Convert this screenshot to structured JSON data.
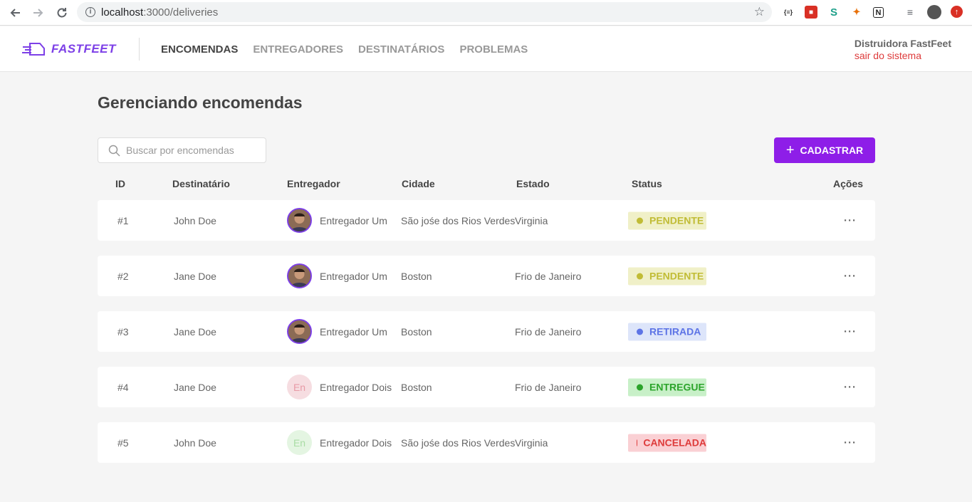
{
  "browser": {
    "url_host": "localhost",
    "url_path": ":3000/deliveries"
  },
  "header": {
    "logo_text": "FASTFEET",
    "nav": [
      {
        "label": "ENCOMENDAS",
        "active": true
      },
      {
        "label": "ENTREGADORES",
        "active": false
      },
      {
        "label": "DESTINATÁRIOS",
        "active": false
      },
      {
        "label": "PROBLEMAS",
        "active": false
      }
    ],
    "user_name": "Distruidora FastFeet",
    "logout_label": "sair do sistema"
  },
  "main": {
    "title": "Gerenciando encomendas",
    "search_placeholder": "Buscar por encomendas",
    "add_button_label": "CADASTRAR",
    "columns": [
      "ID",
      "Destinatário",
      "Entregador",
      "Cidade",
      "Estado",
      "Status",
      "Ações"
    ],
    "rows": [
      {
        "id": "#1",
        "recipient": "John Doe",
        "deliveryman": "Entregador Um",
        "avatar": "photo",
        "city": "São jośe dos Rios Verdes",
        "state": "Virginia",
        "status": "PENDENTE",
        "actions": "···"
      },
      {
        "id": "#2",
        "recipient": "Jane Doe",
        "deliveryman": "Entregador Um",
        "avatar": "photo",
        "city": "Boston",
        "state": "Frio de Janeiro",
        "status": "PENDENTE",
        "actions": "···"
      },
      {
        "id": "#3",
        "recipient": "Jane Doe",
        "deliveryman": "Entregador Um",
        "avatar": "photo",
        "city": "Boston",
        "state": "Frio de Janeiro",
        "status": "RETIRADA",
        "actions": "···"
      },
      {
        "id": "#4",
        "recipient": "Jane Doe",
        "deliveryman": "Entregador Dois",
        "avatar": "En",
        "avatar_bg": "#f6dde1",
        "avatar_color": "#e89aa6",
        "city": "Boston",
        "state": "Frio de Janeiro",
        "status": "ENTREGUE",
        "actions": "···"
      },
      {
        "id": "#5",
        "recipient": "John Doe",
        "deliveryman": "Entregador Dois",
        "avatar": "En",
        "avatar_bg": "#e4f5e2",
        "avatar_color": "#a9dca4",
        "city": "São jośe dos Rios Verdes",
        "state": "Virginia",
        "status": "CANCELADA",
        "actions": "···"
      }
    ]
  },
  "status_colors": {
    "PENDENTE": {
      "bg": "#f0f0c8",
      "fg": "#c1bc35"
    },
    "RETIRADA": {
      "bg": "#dde5fa",
      "fg": "#5d74e6"
    },
    "ENTREGUE": {
      "bg": "#c8f0c8",
      "fg": "#2ca42b"
    },
    "CANCELADA": {
      "bg": "#fad0d4",
      "fg": "#de3b3b"
    }
  },
  "accent_color": "#7d40e7"
}
